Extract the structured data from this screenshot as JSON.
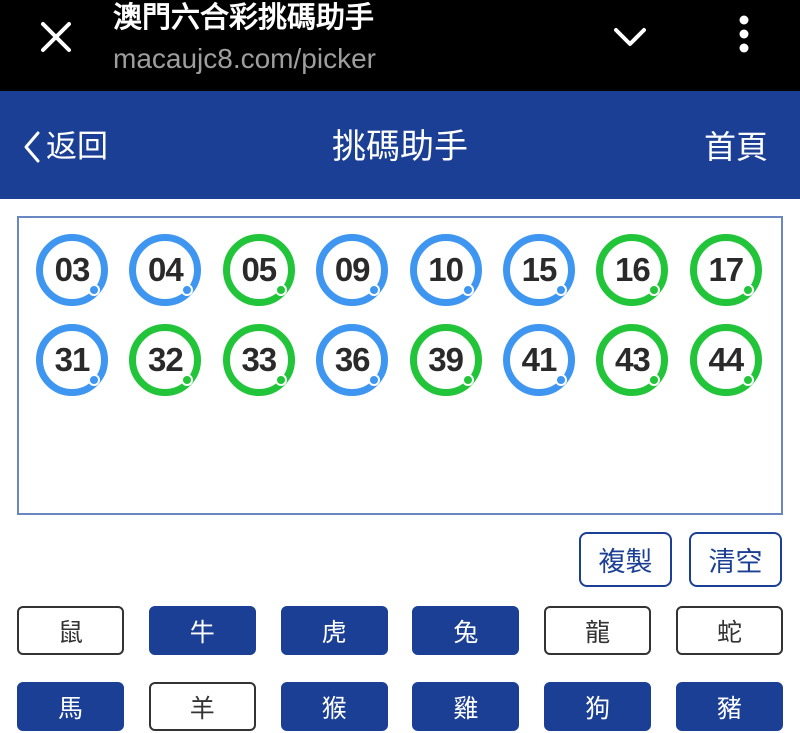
{
  "browser": {
    "page_title": "澳門六合彩挑碼助手",
    "url": "macaujc8.com/picker",
    "close_icon": "close-icon",
    "dropdown_icon": "chevron-down-icon",
    "menu_icon": "more-vert-icon"
  },
  "header": {
    "back_label": "返回",
    "title": "挑碼助手",
    "home_label": "首頁",
    "background": "#1b3f95"
  },
  "numbers": [
    {
      "value": "03",
      "color": "blue"
    },
    {
      "value": "04",
      "color": "blue"
    },
    {
      "value": "05",
      "color": "green"
    },
    {
      "value": "09",
      "color": "blue"
    },
    {
      "value": "10",
      "color": "blue"
    },
    {
      "value": "15",
      "color": "blue"
    },
    {
      "value": "16",
      "color": "green"
    },
    {
      "value": "17",
      "color": "green"
    },
    {
      "value": "31",
      "color": "blue"
    },
    {
      "value": "32",
      "color": "green"
    },
    {
      "value": "33",
      "color": "green"
    },
    {
      "value": "36",
      "color": "blue"
    },
    {
      "value": "39",
      "color": "green"
    },
    {
      "value": "41",
      "color": "blue"
    },
    {
      "value": "43",
      "color": "green"
    },
    {
      "value": "44",
      "color": "green"
    }
  ],
  "colors": {
    "blue": "#3f96f0",
    "green": "#22c43a",
    "accent": "#1b3f95"
  },
  "actions": {
    "copy_label": "複製",
    "clear_label": "清空"
  },
  "zodiacs": [
    {
      "label": "鼠",
      "selected": false
    },
    {
      "label": "牛",
      "selected": true
    },
    {
      "label": "虎",
      "selected": true
    },
    {
      "label": "兔",
      "selected": true
    },
    {
      "label": "龍",
      "selected": false
    },
    {
      "label": "蛇",
      "selected": false
    },
    {
      "label": "馬",
      "selected": true
    },
    {
      "label": "羊",
      "selected": false
    },
    {
      "label": "猴",
      "selected": true
    },
    {
      "label": "雞",
      "selected": true
    },
    {
      "label": "狗",
      "selected": true
    },
    {
      "label": "豬",
      "selected": true
    }
  ]
}
